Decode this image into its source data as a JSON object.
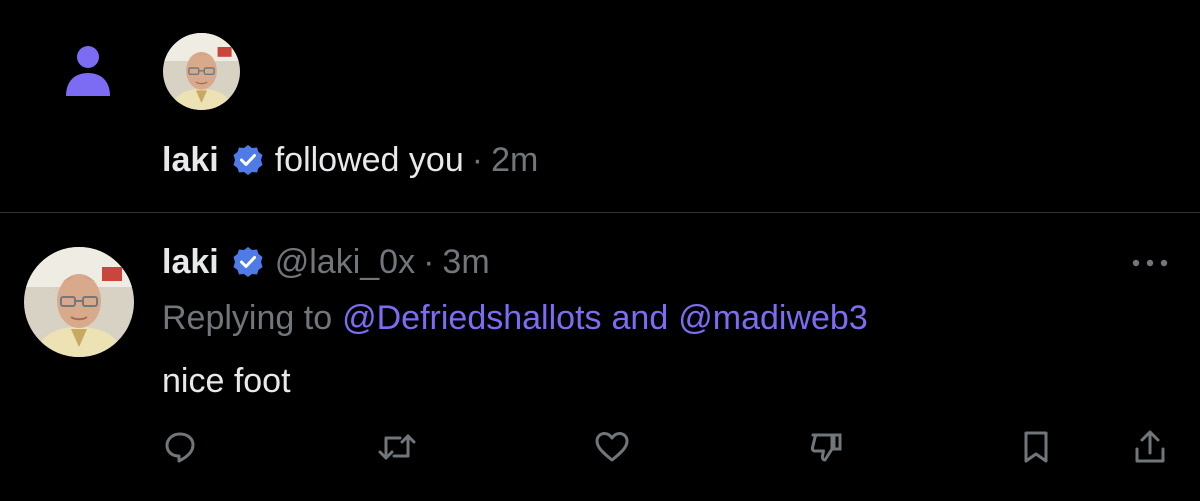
{
  "colors": {
    "background": "#000000",
    "text": "#e7e9ea",
    "muted": "#71767b",
    "accent": "#7c6cf4",
    "verified": "#4f7be8",
    "divider": "#2f3336"
  },
  "follow_notification": {
    "icon": "person-icon",
    "user_name": "laki",
    "verified": true,
    "action_text": "followed you",
    "separator": "·",
    "time": "2m"
  },
  "tweet": {
    "user_name": "laki",
    "verified": true,
    "handle": "@laki_0x",
    "separator": "·",
    "time": "3m",
    "replying_prefix": "Replying to",
    "reply_mention_1": "@Defriedshallots",
    "reply_conjunction": "and",
    "reply_mention_2": "@madiweb3",
    "body": "nice foot",
    "actions": [
      "reply-icon",
      "retweet-icon",
      "like-icon",
      "dislike-icon",
      "bookmark-icon",
      "share-icon"
    ],
    "more_icon": "more-icon"
  }
}
